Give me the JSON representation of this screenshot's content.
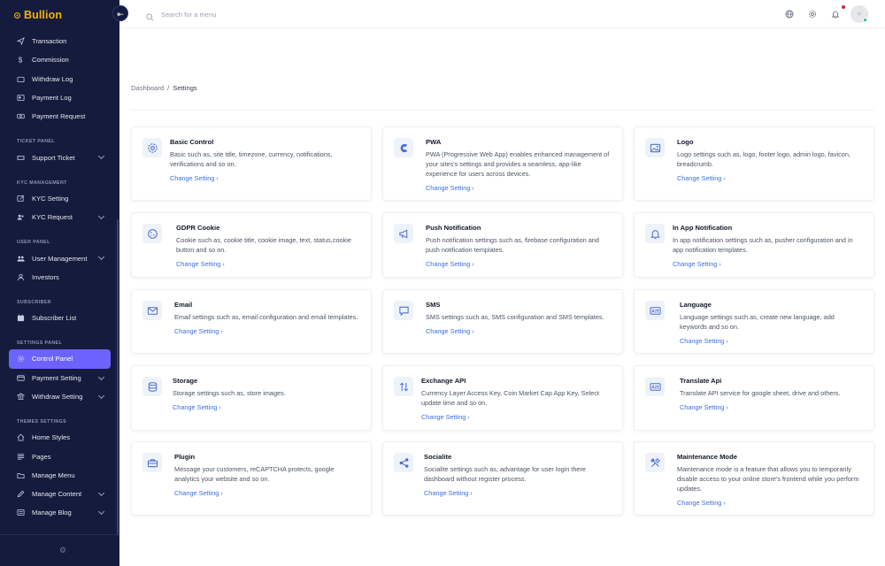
{
  "brand": {
    "name": "Bullion"
  },
  "sidebar": {
    "groups": [
      {
        "heading": "",
        "items": [
          {
            "label": "Transaction",
            "icon": "send-icon",
            "chevron": false
          },
          {
            "label": "Commission",
            "icon": "dollar-icon",
            "chevron": false
          },
          {
            "label": "Withdraw Log",
            "icon": "wallet-icon",
            "chevron": false
          },
          {
            "label": "Payment Log",
            "icon": "receipt-icon",
            "chevron": false
          },
          {
            "label": "Payment Request",
            "icon": "cash-icon",
            "chevron": false
          }
        ]
      },
      {
        "heading": "TICKET PANEL",
        "items": [
          {
            "label": "Support Ticket",
            "icon": "ticket-icon",
            "chevron": true
          }
        ]
      },
      {
        "heading": "KYC MANAGEMENT",
        "items": [
          {
            "label": "KYC Setting",
            "icon": "edit-icon",
            "chevron": false
          },
          {
            "label": "KYC Request",
            "icon": "users-icon",
            "chevron": true
          }
        ]
      },
      {
        "heading": "USER PANEL",
        "items": [
          {
            "label": "User Management",
            "icon": "user-group-icon",
            "chevron": true
          },
          {
            "label": "Investors",
            "icon": "investors-icon",
            "chevron": false
          }
        ]
      },
      {
        "heading": "SUBSCRIBER",
        "items": [
          {
            "label": "Subscriber List",
            "icon": "subscriber-icon",
            "chevron": false
          }
        ]
      },
      {
        "heading": "SETTINGS PANEL",
        "items": [
          {
            "label": "Control Panel",
            "icon": "gear-icon",
            "chevron": false,
            "active": true
          },
          {
            "label": "Payment Setting",
            "icon": "card-icon",
            "chevron": true
          },
          {
            "label": "Withdraw Setting",
            "icon": "bank-icon",
            "chevron": true
          }
        ]
      },
      {
        "heading": "THEMES SETTINGS",
        "items": [
          {
            "label": "Home Styles",
            "icon": "home-icon",
            "chevron": false
          },
          {
            "label": "Pages",
            "icon": "pages-icon",
            "chevron": false
          },
          {
            "label": "Manage Menu",
            "icon": "menu-icon",
            "chevron": false
          },
          {
            "label": "Manage Content",
            "icon": "pen-icon",
            "chevron": true
          },
          {
            "label": "Manage Blog",
            "icon": "blog-icon",
            "chevron": true
          }
        ]
      }
    ]
  },
  "topbar": {
    "search_placeholder": "Search for a menu"
  },
  "breadcrumb": {
    "root": "Dashboard",
    "separator": "/",
    "current": "Settings"
  },
  "cards": [
    {
      "title": "Basic Control",
      "desc": "Basic such as, site title, timezone, currency, notifications, verifications and so on.",
      "link": "Change Setting",
      "icon": "gear-icon"
    },
    {
      "title": "PWA",
      "desc": "PWA (Progressive Web App) enables enhanced management of your sites's settings and provides a seamless, app-like experience for users across devices.",
      "link": "Change Setting",
      "icon": "pwa-icon"
    },
    {
      "title": "Logo",
      "desc": "Logo settings such as, logo, footer logo, admin logo, favicon, breadcrumb.",
      "link": "Change Setting",
      "icon": "image-icon"
    },
    {
      "title": "GDPR Cookie",
      "desc": "Cookie such as, cookie title, cookie image, text, status,cookie button and so on.",
      "link": "Change Setting",
      "icon": "cookie-icon"
    },
    {
      "title": "Push Notification",
      "desc": "Push notification settings such as, firebase configuration and push notification templates.",
      "link": "Change Setting",
      "icon": "megaphone-icon"
    },
    {
      "title": "In App Notification",
      "desc": "In app notification settings such as, pusher configuration and in app notification templates.",
      "link": "Change Setting",
      "icon": "bell-icon"
    },
    {
      "title": "Email",
      "desc": "Email settings such as, email configuration and email templates.",
      "link": "Change Setting",
      "icon": "mail-icon"
    },
    {
      "title": "SMS",
      "desc": "SMS settings such as, SMS configuration and SMS templates.",
      "link": "Change Setting",
      "icon": "chat-icon"
    },
    {
      "title": "Language",
      "desc": "Language settings such as, create new language, add keywords and so on.",
      "link": "Change Setting",
      "icon": "language-icon"
    },
    {
      "title": "Storage",
      "desc": "Storage settings such as, store images.",
      "link": "Change Setting",
      "icon": "database-icon"
    },
    {
      "title": "Exchange API",
      "desc": "Currency Layer Access Key, Coin Market Cap App Key, Select update time and so on.",
      "link": "Change Setting",
      "icon": "exchange-icon"
    },
    {
      "title": "Translate Api",
      "desc": "Translate API service for google sheet, drive and others.",
      "link": "Change Setting",
      "icon": "translate-icon"
    },
    {
      "title": "Plugin",
      "desc": "Message your customers, reCAPTCHA protects, google analytics your website and so on.",
      "link": "Change Setting",
      "icon": "toolbox-icon"
    },
    {
      "title": "Socialite",
      "desc": "Socialite settings such as, advantage for user login there dashboard without register process.",
      "link": "Change Setting",
      "icon": "share-icon"
    },
    {
      "title": "Maintenance Mode",
      "desc": "Maintenance mode is a feature that allows you to temporarily disable access to your online store's frontend while you perform updates.",
      "link": "Change Setting",
      "icon": "tools-icon"
    }
  ],
  "colors": {
    "sidebar_bg": "#141b3d",
    "brand": "#f5b301",
    "accent": "#6c63ff",
    "link": "#3b6fe0"
  }
}
